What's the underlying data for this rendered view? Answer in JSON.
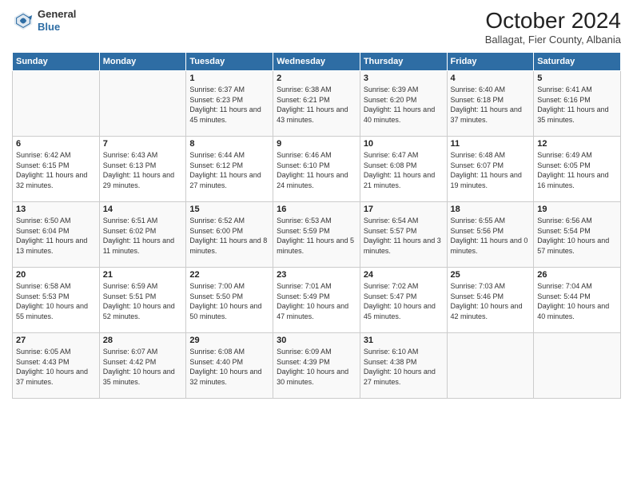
{
  "header": {
    "logo": {
      "line1": "General",
      "line2": "Blue"
    },
    "title": "October 2024",
    "subtitle": "Ballagat, Fier County, Albania"
  },
  "days_of_week": [
    "Sunday",
    "Monday",
    "Tuesday",
    "Wednesday",
    "Thursday",
    "Friday",
    "Saturday"
  ],
  "weeks": [
    [
      {
        "day": "",
        "sunrise": "",
        "sunset": "",
        "daylight": ""
      },
      {
        "day": "",
        "sunrise": "",
        "sunset": "",
        "daylight": ""
      },
      {
        "day": "1",
        "sunrise": "Sunrise: 6:37 AM",
        "sunset": "Sunset: 6:23 PM",
        "daylight": "Daylight: 11 hours and 45 minutes."
      },
      {
        "day": "2",
        "sunrise": "Sunrise: 6:38 AM",
        "sunset": "Sunset: 6:21 PM",
        "daylight": "Daylight: 11 hours and 43 minutes."
      },
      {
        "day": "3",
        "sunrise": "Sunrise: 6:39 AM",
        "sunset": "Sunset: 6:20 PM",
        "daylight": "Daylight: 11 hours and 40 minutes."
      },
      {
        "day": "4",
        "sunrise": "Sunrise: 6:40 AM",
        "sunset": "Sunset: 6:18 PM",
        "daylight": "Daylight: 11 hours and 37 minutes."
      },
      {
        "day": "5",
        "sunrise": "Sunrise: 6:41 AM",
        "sunset": "Sunset: 6:16 PM",
        "daylight": "Daylight: 11 hours and 35 minutes."
      }
    ],
    [
      {
        "day": "6",
        "sunrise": "Sunrise: 6:42 AM",
        "sunset": "Sunset: 6:15 PM",
        "daylight": "Daylight: 11 hours and 32 minutes."
      },
      {
        "day": "7",
        "sunrise": "Sunrise: 6:43 AM",
        "sunset": "Sunset: 6:13 PM",
        "daylight": "Daylight: 11 hours and 29 minutes."
      },
      {
        "day": "8",
        "sunrise": "Sunrise: 6:44 AM",
        "sunset": "Sunset: 6:12 PM",
        "daylight": "Daylight: 11 hours and 27 minutes."
      },
      {
        "day": "9",
        "sunrise": "Sunrise: 6:46 AM",
        "sunset": "Sunset: 6:10 PM",
        "daylight": "Daylight: 11 hours and 24 minutes."
      },
      {
        "day": "10",
        "sunrise": "Sunrise: 6:47 AM",
        "sunset": "Sunset: 6:08 PM",
        "daylight": "Daylight: 11 hours and 21 minutes."
      },
      {
        "day": "11",
        "sunrise": "Sunrise: 6:48 AM",
        "sunset": "Sunset: 6:07 PM",
        "daylight": "Daylight: 11 hours and 19 minutes."
      },
      {
        "day": "12",
        "sunrise": "Sunrise: 6:49 AM",
        "sunset": "Sunset: 6:05 PM",
        "daylight": "Daylight: 11 hours and 16 minutes."
      }
    ],
    [
      {
        "day": "13",
        "sunrise": "Sunrise: 6:50 AM",
        "sunset": "Sunset: 6:04 PM",
        "daylight": "Daylight: 11 hours and 13 minutes."
      },
      {
        "day": "14",
        "sunrise": "Sunrise: 6:51 AM",
        "sunset": "Sunset: 6:02 PM",
        "daylight": "Daylight: 11 hours and 11 minutes."
      },
      {
        "day": "15",
        "sunrise": "Sunrise: 6:52 AM",
        "sunset": "Sunset: 6:00 PM",
        "daylight": "Daylight: 11 hours and 8 minutes."
      },
      {
        "day": "16",
        "sunrise": "Sunrise: 6:53 AM",
        "sunset": "Sunset: 5:59 PM",
        "daylight": "Daylight: 11 hours and 5 minutes."
      },
      {
        "day": "17",
        "sunrise": "Sunrise: 6:54 AM",
        "sunset": "Sunset: 5:57 PM",
        "daylight": "Daylight: 11 hours and 3 minutes."
      },
      {
        "day": "18",
        "sunrise": "Sunrise: 6:55 AM",
        "sunset": "Sunset: 5:56 PM",
        "daylight": "Daylight: 11 hours and 0 minutes."
      },
      {
        "day": "19",
        "sunrise": "Sunrise: 6:56 AM",
        "sunset": "Sunset: 5:54 PM",
        "daylight": "Daylight: 10 hours and 57 minutes."
      }
    ],
    [
      {
        "day": "20",
        "sunrise": "Sunrise: 6:58 AM",
        "sunset": "Sunset: 5:53 PM",
        "daylight": "Daylight: 10 hours and 55 minutes."
      },
      {
        "day": "21",
        "sunrise": "Sunrise: 6:59 AM",
        "sunset": "Sunset: 5:51 PM",
        "daylight": "Daylight: 10 hours and 52 minutes."
      },
      {
        "day": "22",
        "sunrise": "Sunrise: 7:00 AM",
        "sunset": "Sunset: 5:50 PM",
        "daylight": "Daylight: 10 hours and 50 minutes."
      },
      {
        "day": "23",
        "sunrise": "Sunrise: 7:01 AM",
        "sunset": "Sunset: 5:49 PM",
        "daylight": "Daylight: 10 hours and 47 minutes."
      },
      {
        "day": "24",
        "sunrise": "Sunrise: 7:02 AM",
        "sunset": "Sunset: 5:47 PM",
        "daylight": "Daylight: 10 hours and 45 minutes."
      },
      {
        "day": "25",
        "sunrise": "Sunrise: 7:03 AM",
        "sunset": "Sunset: 5:46 PM",
        "daylight": "Daylight: 10 hours and 42 minutes."
      },
      {
        "day": "26",
        "sunrise": "Sunrise: 7:04 AM",
        "sunset": "Sunset: 5:44 PM",
        "daylight": "Daylight: 10 hours and 40 minutes."
      }
    ],
    [
      {
        "day": "27",
        "sunrise": "Sunrise: 6:05 AM",
        "sunset": "Sunset: 4:43 PM",
        "daylight": "Daylight: 10 hours and 37 minutes."
      },
      {
        "day": "28",
        "sunrise": "Sunrise: 6:07 AM",
        "sunset": "Sunset: 4:42 PM",
        "daylight": "Daylight: 10 hours and 35 minutes."
      },
      {
        "day": "29",
        "sunrise": "Sunrise: 6:08 AM",
        "sunset": "Sunset: 4:40 PM",
        "daylight": "Daylight: 10 hours and 32 minutes."
      },
      {
        "day": "30",
        "sunrise": "Sunrise: 6:09 AM",
        "sunset": "Sunset: 4:39 PM",
        "daylight": "Daylight: 10 hours and 30 minutes."
      },
      {
        "day": "31",
        "sunrise": "Sunrise: 6:10 AM",
        "sunset": "Sunset: 4:38 PM",
        "daylight": "Daylight: 10 hours and 27 minutes."
      },
      {
        "day": "",
        "sunrise": "",
        "sunset": "",
        "daylight": ""
      },
      {
        "day": "",
        "sunrise": "",
        "sunset": "",
        "daylight": ""
      }
    ]
  ]
}
